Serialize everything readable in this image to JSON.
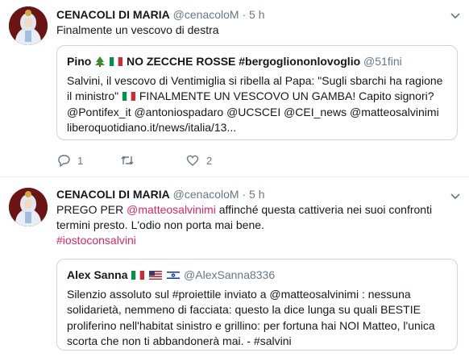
{
  "tweets": [
    {
      "author_name": "CENACOLI DI MARIA",
      "author_handle": "@cenacoloM",
      "dot": "·",
      "time": "5 h",
      "text": "Finalmente un vescovo di destra",
      "quote": {
        "author_name_part1": "Pino",
        "author_name_part2": "NO ZECCHE ROSSE #bergoglionon​lovoglio",
        "author_handle": "@51fini",
        "text_part1": "Salvini, il vescovo di Ventimiglia si ribella al Papa: \"Sugli sbarchi ha ragione il ministro\"",
        "text_part2": "FINALMENTE UN VESCOVO UN GAMBA! Capito signori? @Pontifex_it @antoniospadaro @UCSCEI @CEI_news @matteosalvinimi liberoquotidiano.it/news/italia/13..."
      },
      "replies": "1",
      "retweets": "",
      "likes": "2"
    },
    {
      "author_name": "CENACOLI DI MARIA",
      "author_handle": "@cenacoloM",
      "dot": "·",
      "time": "5 h",
      "text_part1": "PREGO PER",
      "mention": "@matteosalvinimi",
      "text_part2": "affinché questa cattiveria nei suoi confronti termini presto. L'odio non porta mai bene.",
      "hashtag": "#iostoconsalvini",
      "quote": {
        "author_name": "Alex Sanna",
        "author_handle": "@AlexSanna8336",
        "text": "Silenzio assoluto sul #proiettile inviato a @matteosalvinimi : nessuna solidarietà, nemmeno di facciata: questo la dice lunga su quali BESTIE proliferino nell'habitat sinistro e grillino: per fortuna hai NOI Matteo, l'unica scorta che non ti abbandonerà mai. - #salvini"
      }
    }
  ],
  "icons": {
    "reply": "reply-icon",
    "retweet": "retweet-icon",
    "like": "heart-icon",
    "caret": "chevron-down-icon"
  },
  "colors": {
    "accent": "#e0245e",
    "secondary_text": "#657786",
    "border": "#e6ecf0"
  }
}
